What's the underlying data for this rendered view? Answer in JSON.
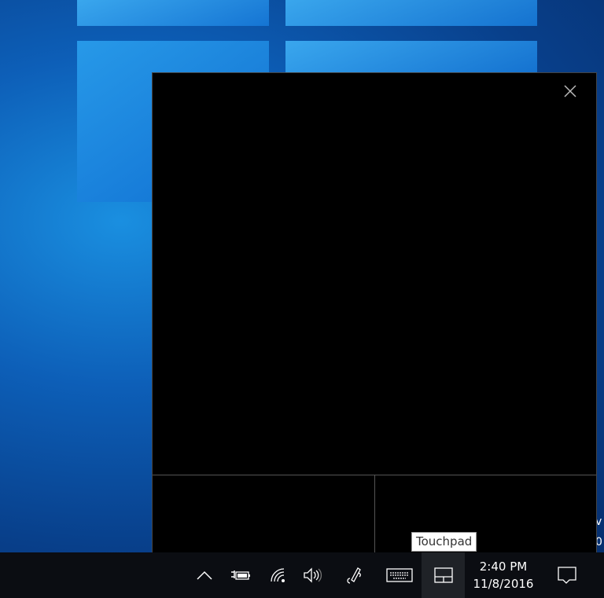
{
  "desktop": {
    "fragments": [
      "v",
      "0"
    ]
  },
  "touchpad": {
    "close_icon": "close-icon"
  },
  "tooltip": {
    "text": "Touchpad"
  },
  "taskbar": {
    "icons": [
      "chevron-up-icon",
      "battery-charging-icon",
      "wifi-icon",
      "volume-icon",
      "pen-icon",
      "keyboard-icon",
      "touchpad-icon",
      "action-center-icon"
    ],
    "time": "2:40 PM",
    "date": "11/8/2016"
  }
}
